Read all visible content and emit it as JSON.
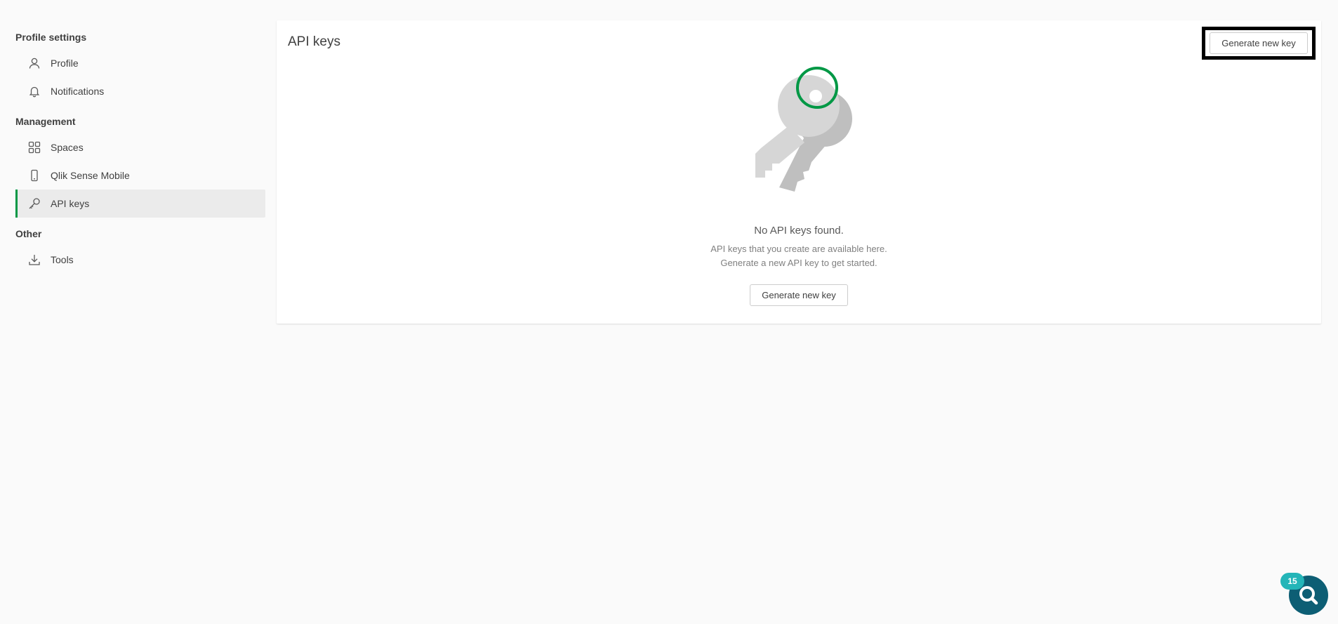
{
  "sidebar": {
    "sections": [
      {
        "heading": "Profile settings",
        "items": [
          {
            "label": "Profile",
            "icon": "user-icon"
          },
          {
            "label": "Notifications",
            "icon": "bell-icon"
          }
        ]
      },
      {
        "heading": "Management",
        "items": [
          {
            "label": "Spaces",
            "icon": "grid-icon"
          },
          {
            "label": "Qlik Sense Mobile",
            "icon": "mobile-icon"
          },
          {
            "label": "API keys",
            "icon": "key-icon",
            "active": true
          }
        ]
      },
      {
        "heading": "Other",
        "items": [
          {
            "label": "Tools",
            "icon": "download-icon"
          }
        ]
      }
    ]
  },
  "main": {
    "title": "API keys",
    "header_button": "Generate new key",
    "empty_state": {
      "title": "No API keys found.",
      "line1": "API keys that you create are available here.",
      "line2": "Generate a new API key to get started.",
      "button": "Generate new key"
    }
  },
  "assistant": {
    "badge_count": "15",
    "icon": "assistant-search-icon"
  },
  "colors": {
    "accent": "#009845",
    "fab": "#0d5e74",
    "badge": "#24b5b8"
  }
}
